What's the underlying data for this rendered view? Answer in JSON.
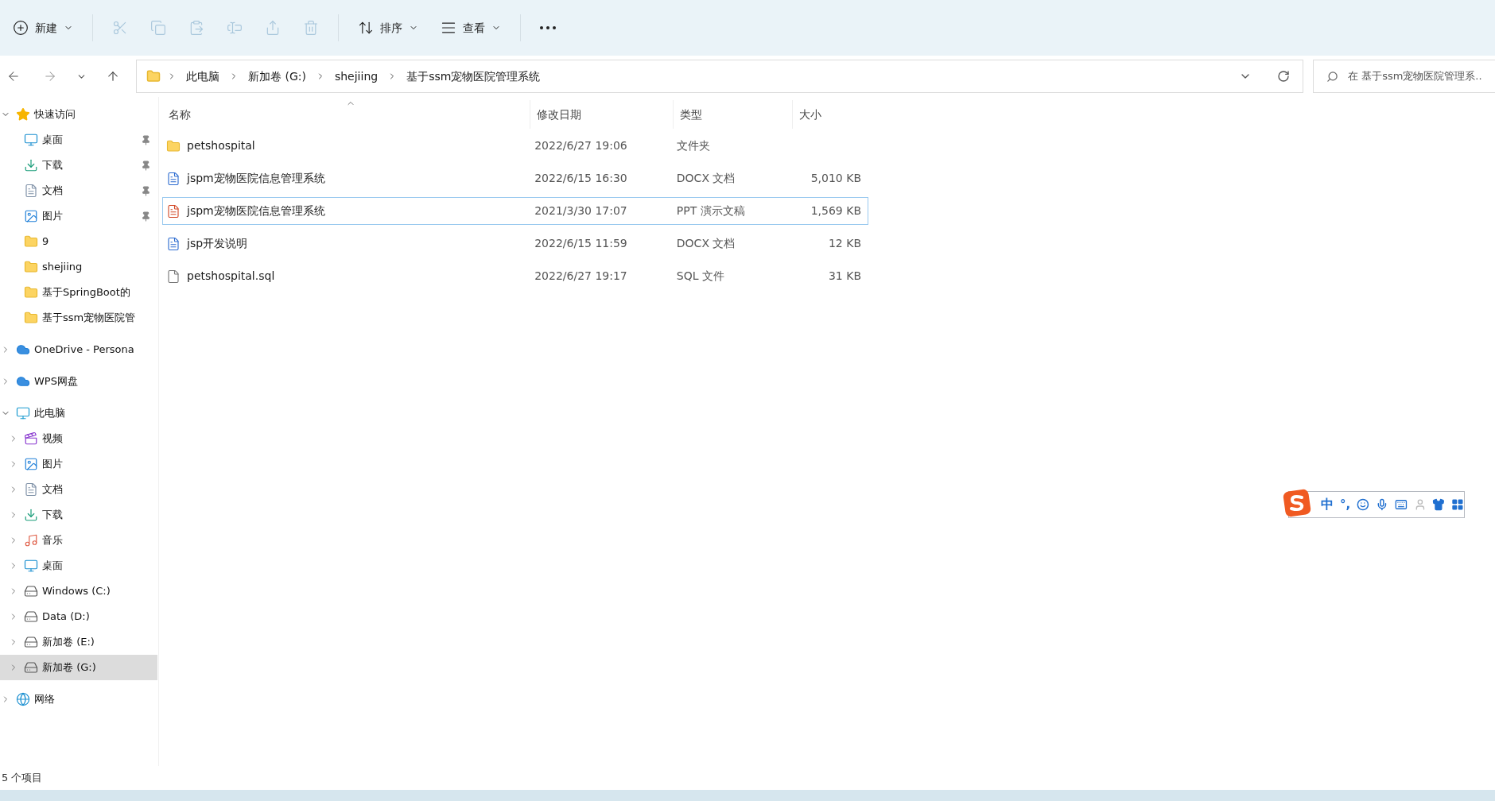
{
  "toolbar": [
    {
      "kind": "new",
      "label": "新建",
      "dropdown": true,
      "disabled": false
    },
    {
      "kind": "cut",
      "disabled": true
    },
    {
      "kind": "copy",
      "disabled": true
    },
    {
      "kind": "paste",
      "disabled": true
    },
    {
      "kind": "rename",
      "disabled": true
    },
    {
      "kind": "share",
      "disabled": true
    },
    {
      "kind": "delete",
      "disabled": true
    },
    {
      "kind": "sort",
      "label": "排序",
      "dropdown": true,
      "disabled": false
    },
    {
      "kind": "view",
      "label": "查看",
      "dropdown": true,
      "disabled": false
    },
    {
      "kind": "more",
      "disabled": false
    }
  ],
  "address_bar": {
    "breadcrumbs": [
      "此电脑",
      "新加卷 (G:)",
      "shejiing",
      "基于ssm宠物医院管理系统"
    ]
  },
  "search": {
    "placeholder": "在 基于ssm宠物医院管理系.."
  },
  "sidebar": {
    "items": [
      {
        "kind": "star",
        "label": "快速访问",
        "expanded": true,
        "selected": false,
        "children": [
          {
            "kind": "desktop",
            "label": "桌面",
            "pinned": true,
            "selected": false
          },
          {
            "kind": "download",
            "label": "下载",
            "pinned": true,
            "selected": false
          },
          {
            "kind": "documents",
            "label": "文档",
            "pinned": true,
            "selected": false
          },
          {
            "kind": "pictures",
            "label": "图片",
            "pinned": true,
            "selected": false
          },
          {
            "kind": "folder",
            "label": "9",
            "pinned": false,
            "selected": false
          },
          {
            "kind": "folder",
            "label": "shejiing",
            "pinned": false,
            "selected": false
          },
          {
            "kind": "folder",
            "label": "基于SpringBoot的",
            "pinned": false,
            "selected": false
          },
          {
            "kind": "folder",
            "label": "基于ssm宠物医院管",
            "pinned": false,
            "selected": false
          }
        ]
      },
      {
        "kind": "cloud",
        "label": "OneDrive - Persona",
        "expanded": false,
        "selected": false
      },
      {
        "kind": "cloud",
        "label": "WPS网盘",
        "expanded": false,
        "selected": false
      },
      {
        "kind": "pc",
        "label": "此电脑",
        "expanded": true,
        "selected": false,
        "children": [
          {
            "kind": "video",
            "label": "视频",
            "expanded": false,
            "selected": false
          },
          {
            "kind": "pictures",
            "label": "图片",
            "expanded": false,
            "selected": false
          },
          {
            "kind": "documents",
            "label": "文档",
            "expanded": false,
            "selected": false
          },
          {
            "kind": "download",
            "label": "下载",
            "expanded": false,
            "selected": false
          },
          {
            "kind": "music",
            "label": "音乐",
            "expanded": false,
            "selected": false
          },
          {
            "kind": "desktop",
            "label": "桌面",
            "expanded": false,
            "selected": false
          },
          {
            "kind": "drive",
            "label": "Windows (C:)",
            "expanded": false,
            "selected": false
          },
          {
            "kind": "drive",
            "label": "Data (D:)",
            "expanded": false,
            "selected": false
          },
          {
            "kind": "drive",
            "label": "新加卷 (E:)",
            "expanded": false,
            "selected": false
          },
          {
            "kind": "drive",
            "label": "新加卷 (G:)",
            "expanded": false,
            "selected": true
          }
        ]
      },
      {
        "kind": "network",
        "label": "网络",
        "expanded": false,
        "selected": false
      }
    ]
  },
  "table": {
    "columns": [
      {
        "label": "名称",
        "sorted": true
      },
      {
        "label": "修改日期",
        "sorted": false
      },
      {
        "label": "类型",
        "sorted": false
      },
      {
        "label": "大小",
        "sorted": false
      }
    ],
    "rows": [
      {
        "kind": "folder",
        "name": "petshospital",
        "date": "2022/6/27 19:06",
        "type": "文件夹",
        "size": "",
        "selected": false
      },
      {
        "kind": "word",
        "name": "jspm宠物医院信息管理系统",
        "date": "2022/6/15 16:30",
        "type": "DOCX 文档",
        "size": "5,010 KB",
        "selected": false
      },
      {
        "kind": "ppt",
        "name": "jspm宠物医院信息管理系统",
        "date": "2021/3/30 17:07",
        "type": "PPT 演示文稿",
        "size": "1,569 KB",
        "selected": true
      },
      {
        "kind": "word",
        "name": "jsp开发说明",
        "date": "2022/6/15 11:59",
        "type": "DOCX 文档",
        "size": "12 KB",
        "selected": false
      },
      {
        "kind": "file",
        "name": "petshospital.sql",
        "date": "2022/6/27 19:17",
        "type": "SQL 文件",
        "size": "31 KB",
        "selected": false
      }
    ]
  },
  "status_bar": {
    "item_count": "5 个项目"
  },
  "ime_toolbar": {
    "mode": "中",
    "punctuation": "°,"
  }
}
